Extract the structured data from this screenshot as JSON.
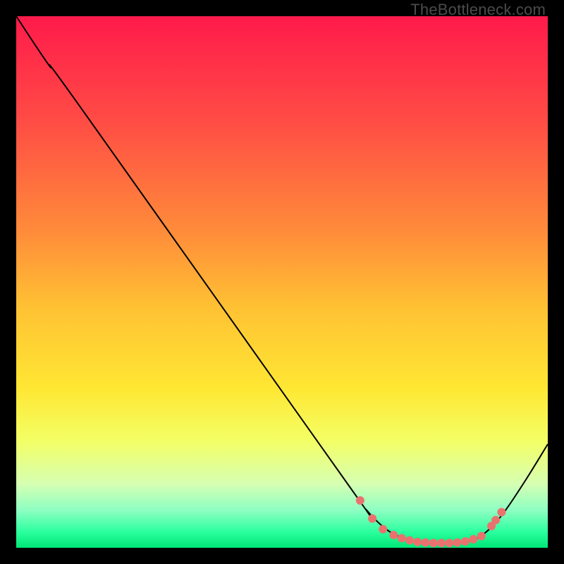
{
  "watermark": "TheBottleneck.com",
  "chart_data": {
    "type": "line",
    "title": "",
    "xlabel": "",
    "ylabel": "",
    "xlim": [
      0,
      100
    ],
    "ylim": [
      0,
      100
    ],
    "gradient_stops": [
      {
        "offset": 0,
        "color": "#ff1a4b"
      },
      {
        "offset": 20,
        "color": "#ff4d45"
      },
      {
        "offset": 40,
        "color": "#ff8a3a"
      },
      {
        "offset": 55,
        "color": "#ffc233"
      },
      {
        "offset": 70,
        "color": "#ffe733"
      },
      {
        "offset": 80,
        "color": "#f3ff66"
      },
      {
        "offset": 88,
        "color": "#d6ffb3"
      },
      {
        "offset": 93,
        "color": "#8cffc2"
      },
      {
        "offset": 97,
        "color": "#2bff9e"
      },
      {
        "offset": 100,
        "color": "#00e676"
      }
    ],
    "series": [
      {
        "name": "bottleneck-curve",
        "color": "#000000",
        "points": [
          {
            "x": 0.0,
            "y": 100.0
          },
          {
            "x": 6.0,
            "y": 91.0
          },
          {
            "x": 12.0,
            "y": 83.0
          },
          {
            "x": 62.0,
            "y": 12.5
          },
          {
            "x": 66.0,
            "y": 7.0
          },
          {
            "x": 70.0,
            "y": 3.2
          },
          {
            "x": 74.0,
            "y": 1.4
          },
          {
            "x": 78.0,
            "y": 0.9
          },
          {
            "x": 82.0,
            "y": 0.9
          },
          {
            "x": 86.0,
            "y": 1.5
          },
          {
            "x": 89.0,
            "y": 3.5
          },
          {
            "x": 92.0,
            "y": 7.0
          },
          {
            "x": 96.0,
            "y": 13.0
          },
          {
            "x": 100.0,
            "y": 19.5
          }
        ]
      }
    ],
    "markers": {
      "name": "sample-dots",
      "color": "#e9726f",
      "radius": 6,
      "points": [
        {
          "x": 64.7,
          "y": 8.9
        },
        {
          "x": 67.0,
          "y": 5.5
        },
        {
          "x": 69.0,
          "y": 3.5
        },
        {
          "x": 71.0,
          "y": 2.4
        },
        {
          "x": 72.5,
          "y": 1.8
        },
        {
          "x": 74.0,
          "y": 1.4
        },
        {
          "x": 75.5,
          "y": 1.1
        },
        {
          "x": 77.0,
          "y": 1.0
        },
        {
          "x": 78.5,
          "y": 0.9
        },
        {
          "x": 80.0,
          "y": 0.9
        },
        {
          "x": 81.5,
          "y": 0.9
        },
        {
          "x": 83.0,
          "y": 1.0
        },
        {
          "x": 84.5,
          "y": 1.2
        },
        {
          "x": 86.0,
          "y": 1.6
        },
        {
          "x": 87.5,
          "y": 2.2
        },
        {
          "x": 89.4,
          "y": 4.1
        },
        {
          "x": 90.2,
          "y": 5.2
        },
        {
          "x": 91.3,
          "y": 6.7
        }
      ]
    }
  }
}
